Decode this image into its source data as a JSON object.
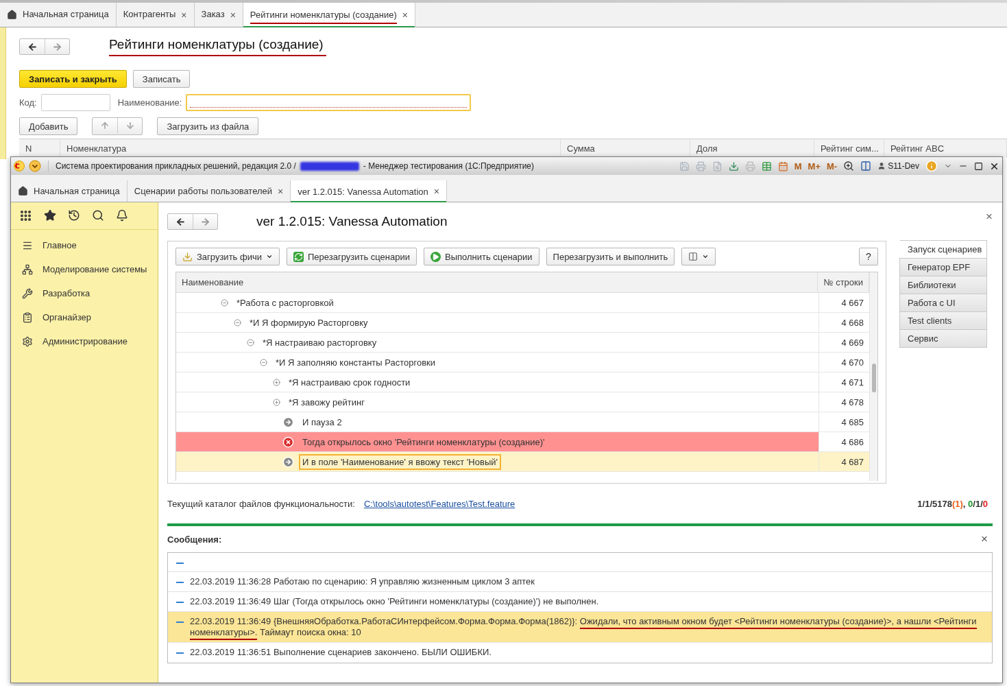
{
  "back_window": {
    "tabs": [
      {
        "label": "Начальная страница",
        "kind": "home",
        "selected": false,
        "annotated": false
      },
      {
        "label": "Контрагенты",
        "kind": "closable",
        "close": "×",
        "selected": false,
        "annotated": false
      },
      {
        "label": "Заказ",
        "kind": "closable",
        "close": "×",
        "selected": false,
        "annotated": false
      },
      {
        "label": "Рейтинги номенклатуры (создание)",
        "kind": "closable",
        "close": "×",
        "selected": true,
        "annotated": true
      }
    ],
    "title": {
      "text": "Рейтинги номенклатуры (создание)",
      "annotated": true
    },
    "buttons": [
      {
        "label": "Записать и закрыть",
        "kind": "primary"
      },
      {
        "label": "Записать",
        "kind": "default"
      }
    ],
    "fields": [
      {
        "label": "Код:",
        "highlighted": false
      },
      {
        "label": "Наименование:",
        "highlighted": true
      }
    ],
    "table_toolbar": {
      "add": "Добавить",
      "load": "Загрузить из файла"
    },
    "columns": [
      "N",
      "Номенклатура",
      "Сумма",
      "Доля",
      "Рейтинг сим...",
      "Рейтинг ABC"
    ]
  },
  "window": {
    "title_start": "Система проектирования прикладных решений, редакция 2.0 /",
    "title_end": "- Менеджер тестирования (1С:Предприятие)",
    "memory_buttons": [
      "M",
      "M+",
      "M-"
    ],
    "user": "S11-Dev",
    "tabs": [
      {
        "label": "Начальная страница",
        "kind": "home",
        "selected": false
      },
      {
        "label": "Сценарии работы пользователей",
        "kind": "closable",
        "close": "×",
        "selected": false
      },
      {
        "label": "ver 1.2.015: Vanessa Automation",
        "kind": "closable",
        "close": "×",
        "selected": true
      }
    ],
    "sidebar": {
      "items": [
        "Главное",
        "Моделирование системы",
        "Разработка",
        "Органайзер",
        "Администрирование"
      ]
    },
    "form": {
      "title": "ver 1.2.015: Vanessa Automation",
      "close": "×",
      "toolbar": [
        {
          "label": "Загрузить фичи",
          "kind": "dropdown"
        },
        {
          "label": "Перезагрузить сценарии",
          "kind": "reload"
        },
        {
          "label": "Выполнить сценарии",
          "kind": "run"
        },
        {
          "label": "Перезагрузить и выполнить",
          "kind": "plain"
        },
        {
          "kind": "columns"
        }
      ],
      "help": "?",
      "tree": {
        "columns": [
          "Наименование",
          "№ строки"
        ],
        "rows": [
          {
            "kind": "group",
            "label": "*Работа с расторговкой",
            "line": "4 667",
            "expanded": true,
            "selected": false,
            "children": [
              {
                "kind": "group",
                "label": "*И Я формирую Расторговку",
                "line": "4 668",
                "expanded": true,
                "selected": false,
                "children": [
                  {
                    "kind": "group",
                    "label": "*Я настраиваю расторговку",
                    "line": "4 669",
                    "expanded": true,
                    "selected": false,
                    "children": [
                      {
                        "kind": "group",
                        "label": "*И Я заполняю константы Расторговки",
                        "line": "4 670",
                        "expanded": true,
                        "selected": false,
                        "children": [
                          {
                            "kind": "group",
                            "label": "*Я настраиваю срок годности",
                            "line": "4 671",
                            "expanded": false,
                            "selected": false
                          },
                          {
                            "kind": "group",
                            "label": "*Я завожу рейтинг",
                            "line": "4 678",
                            "expanded": false,
                            "selected": false
                          },
                          {
                            "kind": "step",
                            "label": "И пауза 2",
                            "line": "4 685",
                            "failed": false,
                            "selected": false
                          },
                          {
                            "kind": "step",
                            "label": "Тогда открылось окно 'Рейтинги номенклатуры (создание)'",
                            "line": "4 686",
                            "failed": true,
                            "selected": false
                          },
                          {
                            "kind": "step",
                            "label": "И в поле 'Наименование' я ввожу текст 'Новый'",
                            "line": "4 687",
                            "failed": false,
                            "selected": true
                          }
                        ]
                      }
                    ]
                  }
                ]
              }
            ]
          }
        ]
      },
      "side_tabs": [
        {
          "label": "Запуск сценариев",
          "selected": true
        },
        {
          "label": "Генератор EPF",
          "selected": false
        },
        {
          "label": "Библиотеки",
          "selected": false
        },
        {
          "label": "Работа с UI",
          "selected": false
        },
        {
          "label": "Test clients",
          "selected": false
        },
        {
          "label": "Сервис",
          "selected": false
        }
      ],
      "catalog": {
        "label": "Текущий каталог файлов функциональности:",
        "link": "C:\\tools\\autotest\\Features\\Test.feature"
      },
      "counters": [
        {
          "text": "1/1/5178",
          "color": "#333333"
        },
        {
          "text": "(1)",
          "color": "#e8601c"
        },
        {
          "text": ", ",
          "color": "#333333"
        },
        {
          "text": "0",
          "color": "#1a9a2a"
        },
        {
          "text": "/1/",
          "color": "#333333"
        },
        {
          "text": "0",
          "color": "#e02020"
        }
      ],
      "messages": {
        "title": "Сообщения:",
        "close": "×",
        "items": [
          {
            "kind": "blank",
            "selected": false
          },
          {
            "kind": "text",
            "selected": false,
            "segments": [
              {
                "text": "22.03.2019 11:36:28 Работаю по сценарию: Я управляю жизненным циклом 3 аптек"
              }
            ]
          },
          {
            "kind": "text",
            "selected": false,
            "segments": [
              {
                "text": "22.03.2019 11:36:49 Шаг (Тогда открылось окно 'Рейтинги номенклатуры (создание)') не выполнен."
              }
            ]
          },
          {
            "kind": "text",
            "selected": true,
            "segments": [
              {
                "text": "22.03.2019 11:36:49 {ВнешняяОбработка.РаботаСИнтерфейсом.Форма.Форма.Форма(1862)}: "
              },
              {
                "text": "Ожидали, что активным окном будет <Рейтинги номенклатуры (создание)>, а нашли <Рейтинги номенклатуры>.",
                "annotated": true
              },
              {
                "text": " Таймаут поиска окна: 10"
              }
            ]
          },
          {
            "kind": "text",
            "selected": false,
            "segments": [
              {
                "text": "22.03.2019 11:36:51 Выполнение сценариев закончено. БЫЛИ ОШИБКИ."
              }
            ]
          }
        ]
      }
    }
  }
}
